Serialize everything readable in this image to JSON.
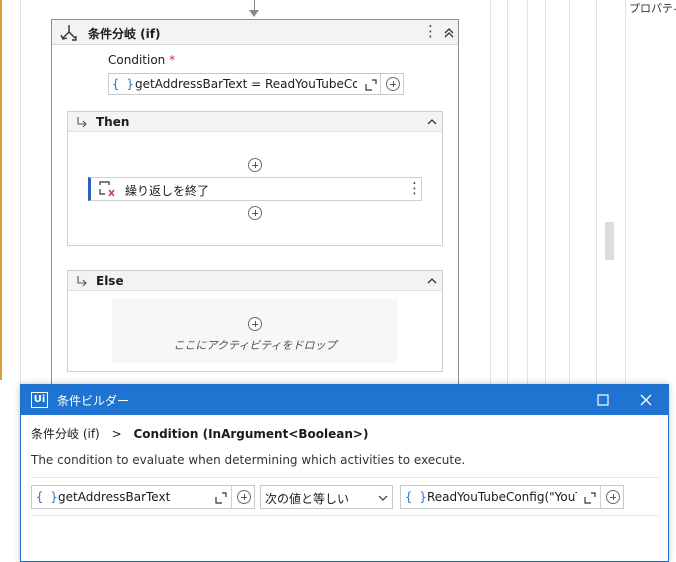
{
  "properties_panel": {
    "label": "プロパティ("
  },
  "if_activity": {
    "title": "条件分岐 (if)",
    "condition": {
      "label": "Condition",
      "required_mark": "*",
      "brace": "{ }",
      "expression": "getAddressBarText = ReadYouTubeConfig("
    },
    "then_branch": {
      "label": "Then",
      "inner_activity": {
        "label": "繰り返しを終了"
      }
    },
    "else_branch": {
      "label": "Else",
      "drop_hint": "ここにアクティビティをドロップ"
    }
  },
  "condition_builder": {
    "title": "条件ビルダー",
    "logo_text": "Ui",
    "breadcrumb": {
      "parent": "条件分岐 (if)",
      "separator": ">",
      "current": "Condition (InArgument<Boolean>)"
    },
    "description": "The condition to evaluate when determining which activities to execute.",
    "row": {
      "left_brace": "{ }",
      "left_value": "getAddressBarText",
      "operator": "次の値と等しい",
      "right_brace": "{ }",
      "right_value": "ReadYouTubeConfig(\"YouTul"
    }
  },
  "colors": {
    "accent": "#1f73d1",
    "brace": "#2b74c7",
    "required": "#c4314b",
    "break_icon": "#d13438"
  }
}
